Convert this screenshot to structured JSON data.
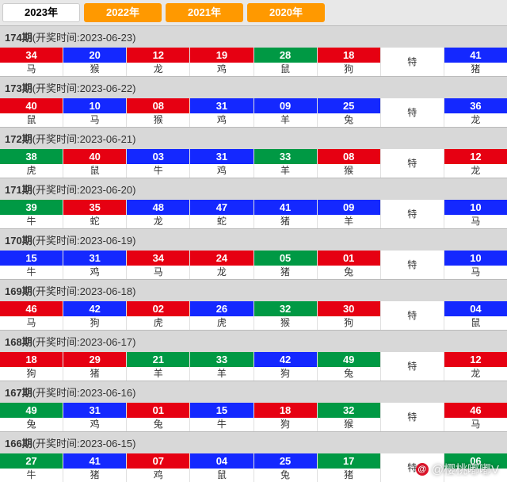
{
  "tabs": [
    {
      "label": "2023年",
      "active": true
    },
    {
      "label": "2022年",
      "active": false
    },
    {
      "label": "2021年",
      "active": false
    },
    {
      "label": "2020年",
      "active": false
    }
  ],
  "draws": [
    {
      "issue": "174期",
      "time_label": "(开奖时间:2023-06-23)",
      "cells": [
        {
          "n": "34",
          "c": "red",
          "z": "马"
        },
        {
          "n": "20",
          "c": "blue",
          "z": "猴"
        },
        {
          "n": "12",
          "c": "red",
          "z": "龙"
        },
        {
          "n": "19",
          "c": "red",
          "z": "鸡"
        },
        {
          "n": "28",
          "c": "green",
          "z": "鼠"
        },
        {
          "n": "18",
          "c": "red",
          "z": "狗"
        },
        {
          "n": "",
          "c": "none",
          "z": "特"
        },
        {
          "n": "41",
          "c": "blue",
          "z": "猪"
        }
      ]
    },
    {
      "issue": "173期",
      "time_label": "(开奖时间:2023-06-22)",
      "cells": [
        {
          "n": "40",
          "c": "red",
          "z": "鼠"
        },
        {
          "n": "10",
          "c": "blue",
          "z": "马"
        },
        {
          "n": "08",
          "c": "red",
          "z": "猴"
        },
        {
          "n": "31",
          "c": "blue",
          "z": "鸡"
        },
        {
          "n": "09",
          "c": "blue",
          "z": "羊"
        },
        {
          "n": "25",
          "c": "blue",
          "z": "兔"
        },
        {
          "n": "",
          "c": "none",
          "z": "特"
        },
        {
          "n": "36",
          "c": "blue",
          "z": "龙"
        }
      ]
    },
    {
      "issue": "172期",
      "time_label": "(开奖时间:2023-06-21)",
      "cells": [
        {
          "n": "38",
          "c": "green",
          "z": "虎"
        },
        {
          "n": "40",
          "c": "red",
          "z": "鼠"
        },
        {
          "n": "03",
          "c": "blue",
          "z": "牛"
        },
        {
          "n": "31",
          "c": "blue",
          "z": "鸡"
        },
        {
          "n": "33",
          "c": "green",
          "z": "羊"
        },
        {
          "n": "08",
          "c": "red",
          "z": "猴"
        },
        {
          "n": "",
          "c": "none",
          "z": "特"
        },
        {
          "n": "12",
          "c": "red",
          "z": "龙"
        }
      ]
    },
    {
      "issue": "171期",
      "time_label": "(开奖时间:2023-06-20)",
      "cells": [
        {
          "n": "39",
          "c": "green",
          "z": "牛"
        },
        {
          "n": "35",
          "c": "red",
          "z": "蛇"
        },
        {
          "n": "48",
          "c": "blue",
          "z": "龙"
        },
        {
          "n": "47",
          "c": "blue",
          "z": "蛇"
        },
        {
          "n": "41",
          "c": "blue",
          "z": "猪"
        },
        {
          "n": "09",
          "c": "blue",
          "z": "羊"
        },
        {
          "n": "",
          "c": "none",
          "z": "特"
        },
        {
          "n": "10",
          "c": "blue",
          "z": "马"
        }
      ]
    },
    {
      "issue": "170期",
      "time_label": "(开奖时间:2023-06-19)",
      "cells": [
        {
          "n": "15",
          "c": "blue",
          "z": "牛"
        },
        {
          "n": "31",
          "c": "blue",
          "z": "鸡"
        },
        {
          "n": "34",
          "c": "red",
          "z": "马"
        },
        {
          "n": "24",
          "c": "red",
          "z": "龙"
        },
        {
          "n": "05",
          "c": "green",
          "z": "猪"
        },
        {
          "n": "01",
          "c": "red",
          "z": "兔"
        },
        {
          "n": "",
          "c": "none",
          "z": "特"
        },
        {
          "n": "10",
          "c": "blue",
          "z": "马"
        }
      ]
    },
    {
      "issue": "169期",
      "time_label": "(开奖时间:2023-06-18)",
      "cells": [
        {
          "n": "46",
          "c": "red",
          "z": "马"
        },
        {
          "n": "42",
          "c": "blue",
          "z": "狗"
        },
        {
          "n": "02",
          "c": "red",
          "z": "虎"
        },
        {
          "n": "26",
          "c": "blue",
          "z": "虎"
        },
        {
          "n": "32",
          "c": "green",
          "z": "猴"
        },
        {
          "n": "30",
          "c": "red",
          "z": "狗"
        },
        {
          "n": "",
          "c": "none",
          "z": "特"
        },
        {
          "n": "04",
          "c": "blue",
          "z": "鼠"
        }
      ]
    },
    {
      "issue": "168期",
      "time_label": "(开奖时间:2023-06-17)",
      "cells": [
        {
          "n": "18",
          "c": "red",
          "z": "狗"
        },
        {
          "n": "29",
          "c": "red",
          "z": "猪"
        },
        {
          "n": "21",
          "c": "green",
          "z": "羊"
        },
        {
          "n": "33",
          "c": "green",
          "z": "羊"
        },
        {
          "n": "42",
          "c": "blue",
          "z": "狗"
        },
        {
          "n": "49",
          "c": "green",
          "z": "兔"
        },
        {
          "n": "",
          "c": "none",
          "z": "特"
        },
        {
          "n": "12",
          "c": "red",
          "z": "龙"
        }
      ]
    },
    {
      "issue": "167期",
      "time_label": "(开奖时间:2023-06-16)",
      "cells": [
        {
          "n": "49",
          "c": "green",
          "z": "兔"
        },
        {
          "n": "31",
          "c": "blue",
          "z": "鸡"
        },
        {
          "n": "01",
          "c": "red",
          "z": "兔"
        },
        {
          "n": "15",
          "c": "blue",
          "z": "牛"
        },
        {
          "n": "18",
          "c": "red",
          "z": "狗"
        },
        {
          "n": "32",
          "c": "green",
          "z": "猴"
        },
        {
          "n": "",
          "c": "none",
          "z": "特"
        },
        {
          "n": "46",
          "c": "red",
          "z": "马"
        }
      ]
    },
    {
      "issue": "166期",
      "time_label": "(开奖时间:2023-06-15)",
      "cells": [
        {
          "n": "27",
          "c": "green",
          "z": "牛"
        },
        {
          "n": "41",
          "c": "blue",
          "z": "猪"
        },
        {
          "n": "07",
          "c": "red",
          "z": "鸡"
        },
        {
          "n": "04",
          "c": "blue",
          "z": "鼠"
        },
        {
          "n": "25",
          "c": "blue",
          "z": "兔"
        },
        {
          "n": "17",
          "c": "green",
          "z": "猪"
        },
        {
          "n": "",
          "c": "none",
          "z": "特"
        },
        {
          "n": "06",
          "c": "green",
          "z": ""
        }
      ]
    }
  ],
  "watermark": "@樱桃嘟嘟V"
}
